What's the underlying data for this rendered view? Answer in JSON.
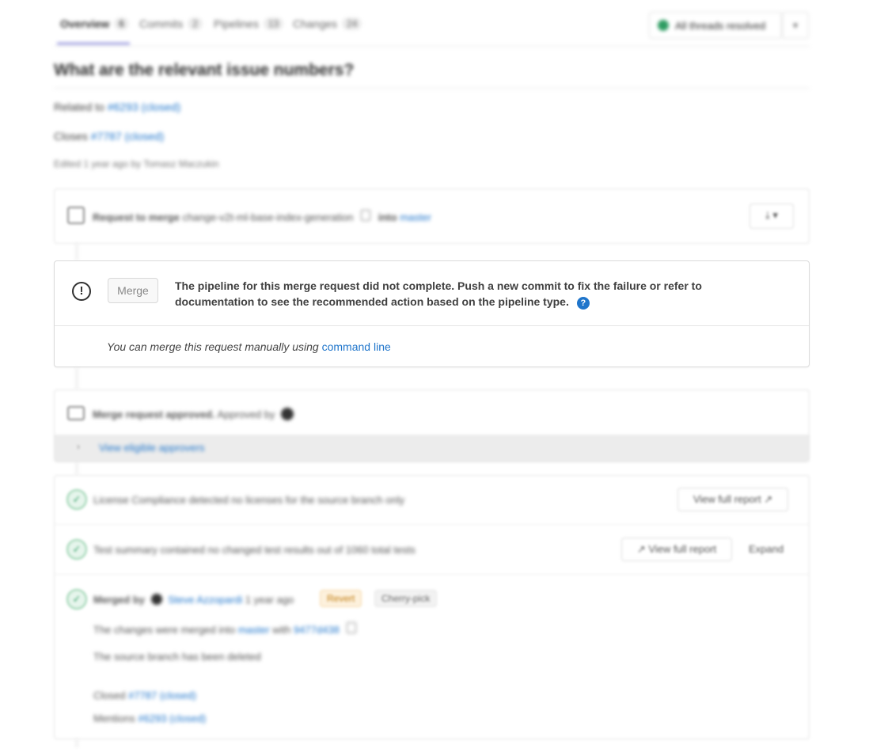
{
  "tabs": [
    {
      "label": "Overview",
      "count": "6"
    },
    {
      "label": "Commits",
      "count": "2"
    },
    {
      "label": "Pipelines",
      "count": "13"
    },
    {
      "label": "Changes",
      "count": "24"
    }
  ],
  "threads": {
    "label": "All threads resolved"
  },
  "description": {
    "heading": "What are the relevant issue numbers?",
    "related_prefix": "Related to",
    "related_link": "#6293 (closed)",
    "closes_prefix": "Closes",
    "closes_link": "#7787 (closed)",
    "edited": "Edited 1 year ago by Tomasz Maczukin"
  },
  "merge_header": {
    "title": "Request to merge",
    "branch": "change-v2t-ml-base-index-generation",
    "into_label": "into",
    "target": "master"
  },
  "merge_box": {
    "button_label": "Merge",
    "message": "The pipeline for this merge request did not complete. Push a new commit to fix the failure or refer to documentation to see the recommended action based on the pipeline type.",
    "manual_text": "You can merge this request manually using",
    "manual_link": "command line"
  },
  "approval": {
    "title": "Merge request approved.",
    "approved_by": "Approved by",
    "eligible_link": "View eligible approvers"
  },
  "license": {
    "text": "License Compliance detected no licenses for the source branch only",
    "button": "View full report"
  },
  "tests": {
    "text": "Test summary contained no changed test results out of 1060 total tests",
    "report_button": "View full report",
    "expand_button": "Expand"
  },
  "merged": {
    "label": "Merged by",
    "user": "Steve Azzopardi",
    "time": "1 year ago",
    "revert": "Revert",
    "cherry_pick": "Cherry-pick",
    "changes_prefix": "The changes were merged into",
    "changes_branch": "master",
    "changes_with": "with",
    "commit": "9477d438",
    "deleted": "The source branch has been deleted",
    "closed_prefix": "Closed",
    "closed_link": "#7787 (closed)",
    "mentions_prefix": "Mentions",
    "mentions_link": "#6293 (closed)"
  }
}
